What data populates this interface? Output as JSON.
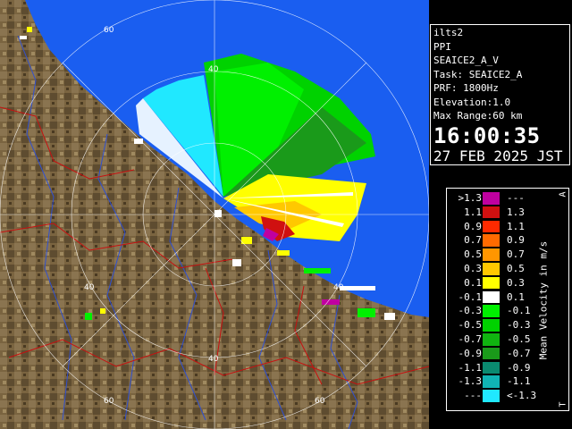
{
  "info": {
    "site": "ilts2",
    "mode": "PPI",
    "scan": "SEAICE2_A_V",
    "task": "Task: SEAICE2_A",
    "prf": "PRF: 1800Hz",
    "elevation": "Elevation:1.0",
    "max_range": "Max Range:60 km",
    "time": "16:00:35",
    "date": "27 FEB 2025 JST"
  },
  "map": {
    "range_ring_labels": [
      "60",
      "40",
      "40",
      "40",
      "40",
      "60",
      "60"
    ],
    "colors": {
      "sea": "#1a5ef0",
      "land": "#7a6440",
      "border": "#c81010",
      "river": "#3050d0",
      "rings": "#ffffff"
    }
  },
  "legend": {
    "title": "Mean Velocity in m/s",
    "corner_top": "A",
    "corner_bottom": "T",
    "rows": [
      {
        "left": ">1.3",
        "right": "---",
        "color": "#c000a0"
      },
      {
        "left": "1.1",
        "right": "1.3",
        "color": "#d01010"
      },
      {
        "left": "0.9",
        "right": "1.1",
        "color": "#ff2a00"
      },
      {
        "left": "0.7",
        "right": "0.9",
        "color": "#ff6a00"
      },
      {
        "left": "0.5",
        "right": "0.7",
        "color": "#ff9600"
      },
      {
        "left": "0.3",
        "right": "0.5",
        "color": "#ffc800"
      },
      {
        "left": "0.1",
        "right": "0.3",
        "color": "#ffff00"
      },
      {
        "left": "-0.1",
        "right": "0.1",
        "color": "#ffffff"
      },
      {
        "left": "-0.3",
        "right": "-0.1",
        "color": "#00f000"
      },
      {
        "left": "-0.5",
        "right": "-0.3",
        "color": "#00d200"
      },
      {
        "left": "-0.7",
        "right": "-0.5",
        "color": "#10b410"
      },
      {
        "left": "-0.9",
        "right": "-0.7",
        "color": "#1a9a1a"
      },
      {
        "left": "-1.1",
        "right": "-0.9",
        "color": "#0a8a70"
      },
      {
        "left": "-1.3",
        "right": "-1.1",
        "color": "#10b4b4"
      },
      {
        "left": "---",
        "right": "<-1.3",
        "color": "#20e8ff"
      }
    ]
  }
}
